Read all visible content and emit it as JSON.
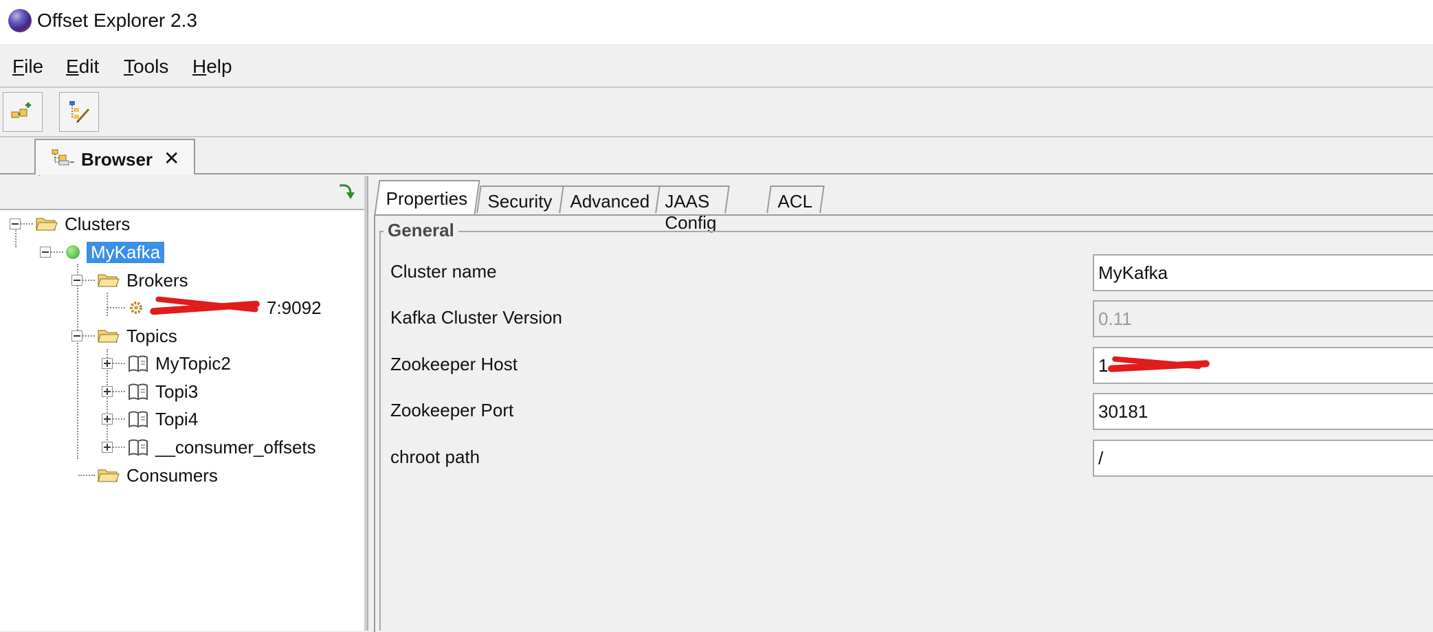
{
  "app": {
    "title": "Offset Explorer  2.3"
  },
  "menu": {
    "items": [
      {
        "mnemonic": "F",
        "rest": "ile"
      },
      {
        "mnemonic": "E",
        "rest": "dit"
      },
      {
        "mnemonic": "T",
        "rest": "ools"
      },
      {
        "mnemonic": "H",
        "rest": "elp"
      }
    ]
  },
  "toolbar": {
    "icons": [
      "add-connection-icon",
      "edit-tree-icon"
    ]
  },
  "browser_tab": {
    "label": "Browser",
    "close": "✕"
  },
  "tree": {
    "clusters": "Clusters",
    "cluster": "MyKafka",
    "brokers": "Brokers",
    "broker_port_suffix": "7:9092",
    "topics": "Topics",
    "topic_items": [
      "MyTopic2",
      "Topi3",
      "Topi4",
      "__consumer_offsets"
    ],
    "consumers": "Consumers"
  },
  "tabs": [
    "Properties",
    "Security",
    "Advanced",
    "JAAS Config",
    "ACL"
  ],
  "general": {
    "title": "General",
    "cluster_name_label": "Cluster name",
    "cluster_name_value": "MyKafka",
    "version_label": "Kafka Cluster Version",
    "version_value": "0.11",
    "zk_host_label": "Zookeeper Host",
    "zk_host_prefix": "1",
    "zk_port_label": "Zookeeper Port",
    "zk_port_value": "30181",
    "chroot_label": "chroot path",
    "chroot_value": "/"
  },
  "colors": {
    "selection": "#3a8fe6",
    "redaction": "#e21b1b",
    "status_online": "#2fa52f"
  }
}
